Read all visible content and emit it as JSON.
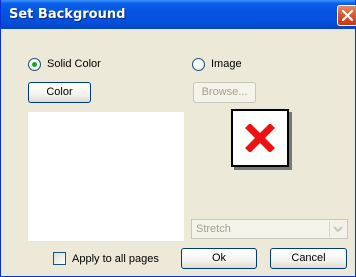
{
  "dialog": {
    "title": "Set Background",
    "solid_color_label": "Solid Color",
    "image_label": "Image",
    "color_button": "Color",
    "browse_button": "Browse...",
    "stretch_value": "Stretch",
    "apply_all_label": "Apply to all pages",
    "ok_button": "Ok",
    "cancel_button": "Cancel",
    "selected_mode": "Solid Color",
    "apply_all_checked": false
  },
  "colors": {
    "accent": "#0453de",
    "solid_color": "#ffffff",
    "placeholder_x": "#ee1111",
    "radio_dot": "#21a121"
  },
  "icons": {
    "close": "close-icon",
    "image_placeholder": "broken-image-x-icon",
    "dropdown": "chevron-down-icon"
  }
}
